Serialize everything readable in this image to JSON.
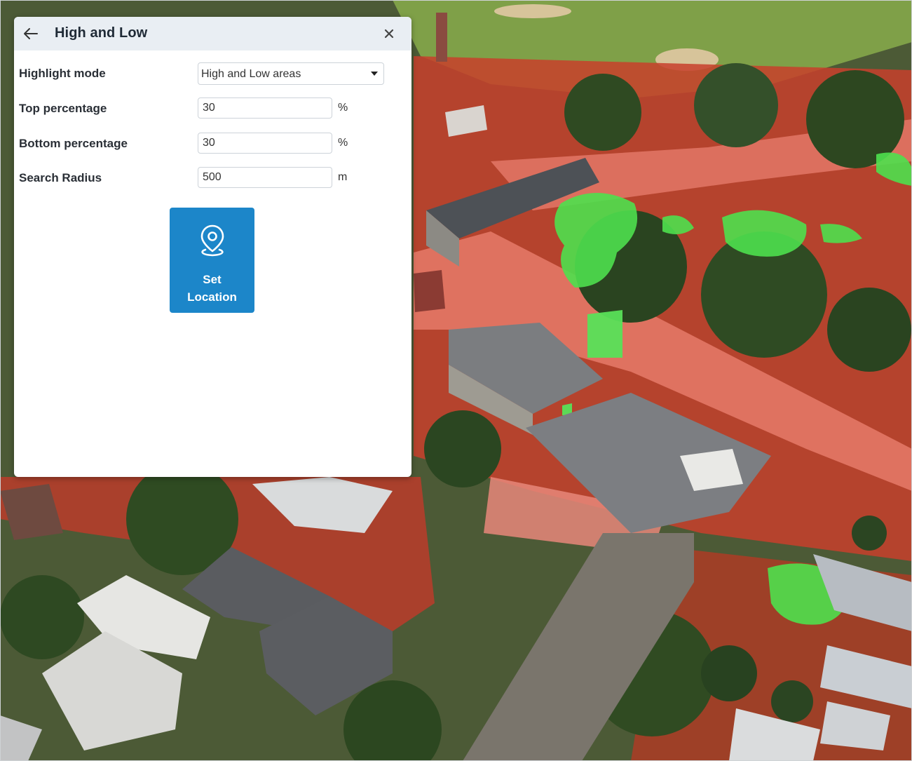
{
  "panel": {
    "title": "High and Low",
    "back_icon": "arrow-left-icon",
    "close_icon": "close-icon"
  },
  "form": {
    "highlight_mode": {
      "label": "Highlight mode",
      "value": "High and Low areas"
    },
    "top_percentage": {
      "label": "Top percentage",
      "value": "30",
      "unit": "%"
    },
    "bottom_percentage": {
      "label": "Bottom percentage",
      "value": "30",
      "unit": "%"
    },
    "search_radius": {
      "label": "Search Radius",
      "value": "500",
      "unit": "m"
    }
  },
  "set_location": {
    "icon": "map-pin-icon",
    "label_line1": "Set",
    "label_line2": "Location"
  },
  "colors": {
    "accent": "#1c86c9",
    "low_area_overlay": "#d83a2c",
    "high_area_overlay": "#3fdc3f",
    "header_bg": "#e9eef3"
  }
}
